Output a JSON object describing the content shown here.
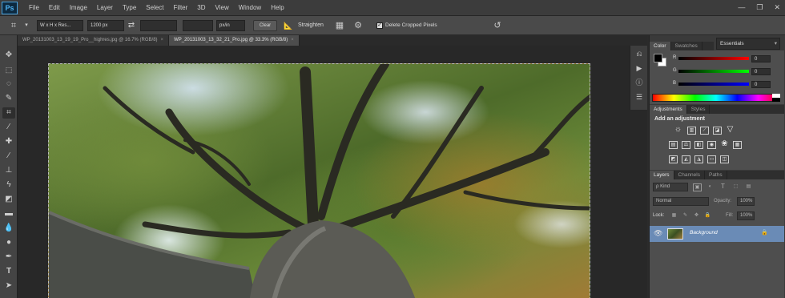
{
  "app": {
    "logo": "Ps"
  },
  "menu": [
    "File",
    "Edit",
    "Image",
    "Layer",
    "Type",
    "Select",
    "Filter",
    "3D",
    "View",
    "Window",
    "Help"
  ],
  "window_controls": {
    "minimize": "—",
    "restore": "❐",
    "close": "✕"
  },
  "options_bar": {
    "ratio_select": "W x H x Res...",
    "width_value": "1200 px",
    "height_value": "",
    "resolution_value": "",
    "unit_select": "px/in",
    "clear_label": "Clear",
    "straighten_label": "Straighten",
    "delete_cropped_label": "Delete Cropped Pixels",
    "delete_cropped_checked": true,
    "workspace": "Essentials"
  },
  "tabs": [
    {
      "label": "WP_20131003_13_19_19_Pro__highres.jpg @ 16.7% (RGB/8)",
      "active": false
    },
    {
      "label": "WP_20131003_13_32_21_Pro.jpg @ 33.3% (RGB/8)",
      "active": true
    }
  ],
  "tools": [
    "move-icon",
    "marquee-icon",
    "lasso-icon",
    "quick-select-icon",
    "crop-icon",
    "eyedropper-icon",
    "healing-brush-icon",
    "brush-icon",
    "clone-stamp-icon",
    "history-brush-icon",
    "eraser-icon",
    "gradient-icon",
    "blur-icon",
    "dodge-icon",
    "pen-icon",
    "type-icon",
    "path-select-icon"
  ],
  "color_panel": {
    "tabs": [
      "Color",
      "Swatches"
    ],
    "foreground": "#000000",
    "background": "#ffffff",
    "channels": [
      {
        "label": "R",
        "value": "0"
      },
      {
        "label": "G",
        "value": "0"
      },
      {
        "label": "B",
        "value": "0"
      }
    ]
  },
  "adjustments_panel": {
    "tabs": [
      "Adjustments",
      "Styles"
    ],
    "title": "Add an adjustment"
  },
  "layers_panel": {
    "tabs": [
      "Layers",
      "Channels",
      "Paths"
    ],
    "kind_filter": "ρ Kind",
    "blend_mode": "Normal",
    "opacity_label": "Opacity:",
    "opacity_value": "100%",
    "lock_label": "Lock:",
    "fill_label": "Fill:",
    "fill_value": "100%",
    "layers": [
      {
        "name": "Background",
        "visible": true,
        "locked": true
      }
    ]
  },
  "colors": {
    "accent": "#6a8bb6",
    "panel": "#4e4e4e",
    "app_bg": "#2b2b2b"
  }
}
